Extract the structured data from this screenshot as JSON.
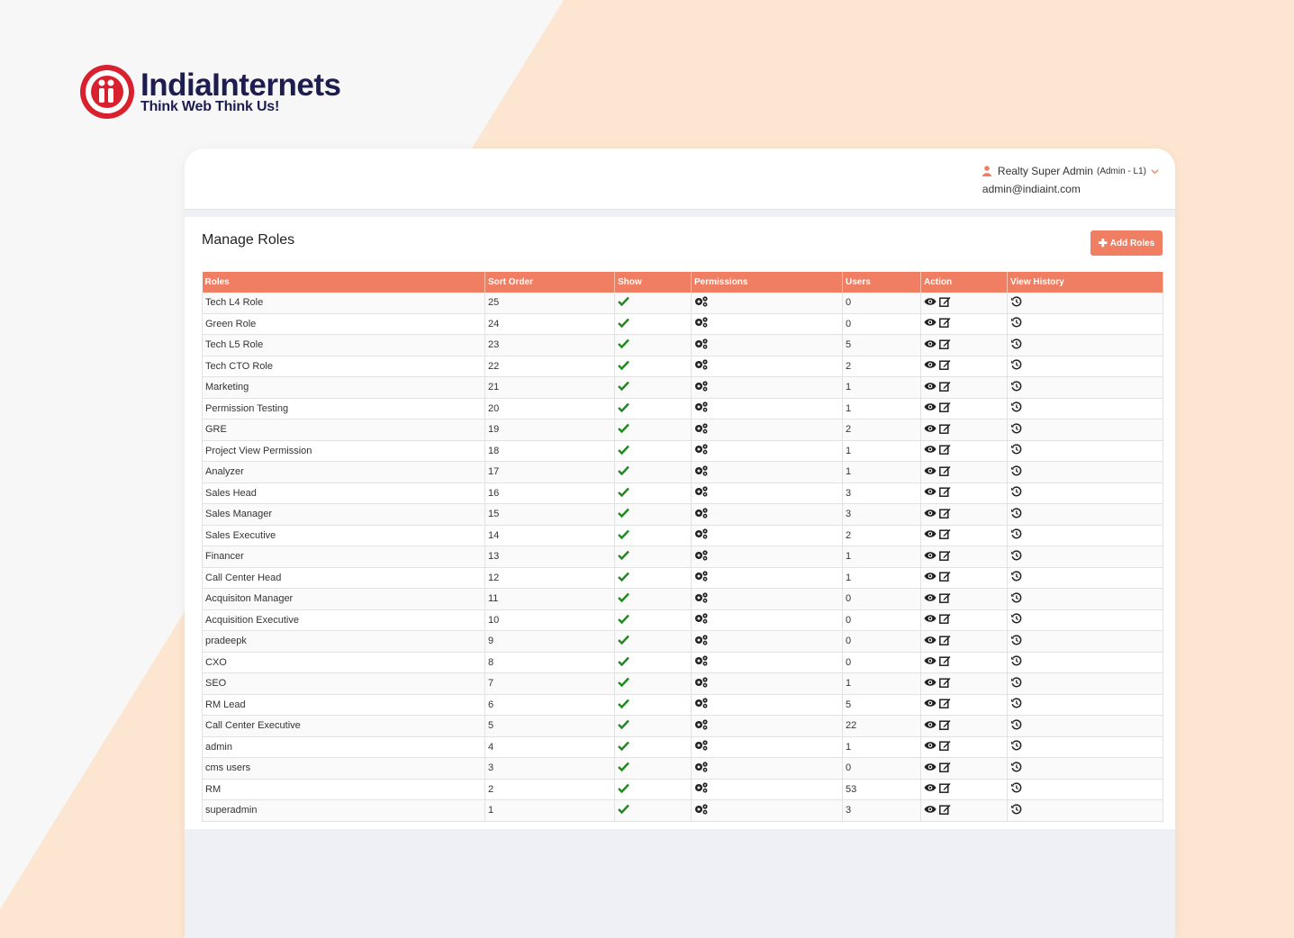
{
  "brand": {
    "name": "IndiaInternets",
    "tagline": "Think Web Think Us!"
  },
  "user": {
    "name": "Realty Super Admin",
    "role": "(Admin - L1)",
    "email": "admin@indiaint.com",
    "icon": "user-icon"
  },
  "page": {
    "title": "Manage Roles",
    "add_button": "Add Roles"
  },
  "table": {
    "headers": [
      "Roles",
      "Sort Order",
      "Show",
      "Permissions",
      "Users",
      "Action",
      "View History"
    ],
    "rows": [
      {
        "role": "Tech L4 Role",
        "sort": "25",
        "users": "0"
      },
      {
        "role": "Green Role",
        "sort": "24",
        "users": "0"
      },
      {
        "role": "Tech L5 Role",
        "sort": "23",
        "users": "5"
      },
      {
        "role": "Tech CTO Role",
        "sort": "22",
        "users": "2"
      },
      {
        "role": "Marketing",
        "sort": "21",
        "users": "1"
      },
      {
        "role": "Permission Testing",
        "sort": "20",
        "users": "1"
      },
      {
        "role": "GRE",
        "sort": "19",
        "users": "2"
      },
      {
        "role": "Project View Permission",
        "sort": "18",
        "users": "1"
      },
      {
        "role": "Analyzer",
        "sort": "17",
        "users": "1"
      },
      {
        "role": "Sales Head",
        "sort": "16",
        "users": "3"
      },
      {
        "role": "Sales Manager",
        "sort": "15",
        "users": "3"
      },
      {
        "role": "Sales Executive",
        "sort": "14",
        "users": "2"
      },
      {
        "role": "Financer",
        "sort": "13",
        "users": "1"
      },
      {
        "role": "Call Center Head",
        "sort": "12",
        "users": "1"
      },
      {
        "role": "Acquisiton Manager",
        "sort": "11",
        "users": "0"
      },
      {
        "role": "Acquisition Executive",
        "sort": "10",
        "users": "0"
      },
      {
        "role": "pradeepk",
        "sort": "9",
        "users": "0"
      },
      {
        "role": "CXO",
        "sort": "8",
        "users": "0"
      },
      {
        "role": "SEO",
        "sort": "7",
        "users": "1"
      },
      {
        "role": "RM Lead",
        "sort": "6",
        "users": "5"
      },
      {
        "role": "Call Center Executive",
        "sort": "5",
        "users": "22"
      },
      {
        "role": "admin",
        "sort": "4",
        "users": "1"
      },
      {
        "role": "cms users",
        "sort": "3",
        "users": "0"
      },
      {
        "role": "RM",
        "sort": "2",
        "users": "53"
      },
      {
        "role": "superadmin",
        "sort": "1",
        "users": "3"
      }
    ]
  },
  "colors": {
    "accent": "#ef7e63",
    "check": "#1e8a1e",
    "brand_red": "#d9202e",
    "brand_navy": "#1d1d4f"
  }
}
